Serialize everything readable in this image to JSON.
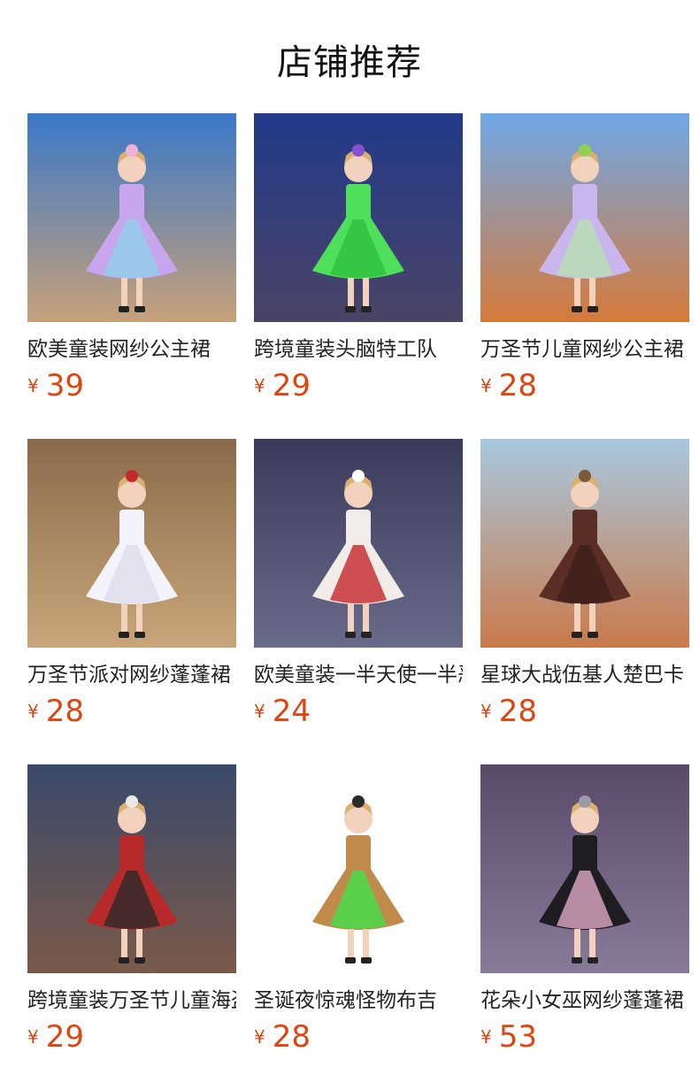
{
  "header": {
    "title": "店铺推荐"
  },
  "currency_symbol": "¥",
  "products": [
    {
      "name": "欧美童装网纱公主裙",
      "price": "39",
      "theme": {
        "bg1": "#3a78c8",
        "bg2": "#c7a17a",
        "dress1": "#c7a6ee",
        "dress2": "#8fd0e8",
        "accent": "#f0b0d8"
      }
    },
    {
      "name": "跨境童装头脑特工队",
      "price": "29",
      "theme": {
        "bg1": "#223a8a",
        "bg2": "#4a4466",
        "dress1": "#4ee05a",
        "dress2": "#2fbf3d",
        "accent": "#8a4fd0"
      }
    },
    {
      "name": "万圣节儿童网纱公主裙",
      "price": "28",
      "theme": {
        "bg1": "#6fa8e8",
        "bg2": "#d67a3a",
        "dress1": "#c9b6ee",
        "dress2": "#b8e0b0",
        "accent": "#8fd04f"
      }
    },
    {
      "name": "万圣节派对网纱蓬蓬裙",
      "price": "28",
      "theme": {
        "bg1": "#8a6a4a",
        "bg2": "#c9a67a",
        "dress1": "#f4f2fa",
        "dress2": "#dedbee",
        "accent": "#c22a2a"
      }
    },
    {
      "name": "欧美童装一半天使一半恶魔",
      "price": "24",
      "theme": {
        "bg1": "#3a3a5a",
        "bg2": "#6a6a8a",
        "dress1": "#f2ece8",
        "dress2": "#c4282a",
        "accent": "#ffffff"
      }
    },
    {
      "name": "星球大战伍基人楚巴卡",
      "price": "28",
      "theme": {
        "bg1": "#a8c8e0",
        "bg2": "#c97a4a",
        "dress1": "#5a2e26",
        "dress2": "#3f1f1a",
        "accent": "#7a5a3a"
      }
    },
    {
      "name": "跨境童装万圣节儿童海盗",
      "price": "29",
      "theme": {
        "bg1": "#3a4a6a",
        "bg2": "#7a5a4a",
        "dress1": "#b82a2a",
        "dress2": "#2a2a2a",
        "accent": "#e8e8e8"
      }
    },
    {
      "name": "圣诞夜惊魂怪物布吉",
      "price": "28",
      "theme": {
        "bg1": "#ffffff",
        "bg2": "#ffffff",
        "dress1": "#c08a4a",
        "dress2": "#3fe04a",
        "accent": "#2a2a2a"
      }
    },
    {
      "name": "花朵小女巫网纱蓬蓬裙",
      "price": "53",
      "theme": {
        "bg1": "#5a4a6a",
        "bg2": "#8a7a9a",
        "dress1": "#1e1e22",
        "dress2": "#e0a8c8",
        "accent": "#9a9aa8"
      }
    }
  ]
}
